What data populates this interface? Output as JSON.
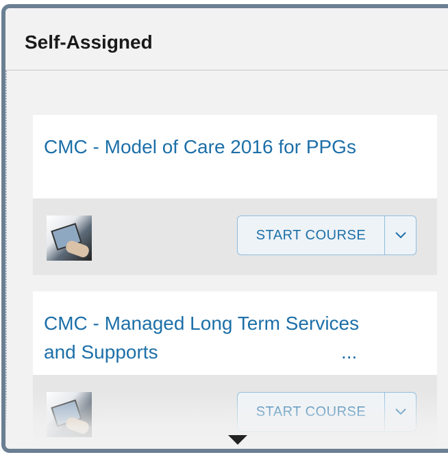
{
  "panel": {
    "title": "Self-Assigned"
  },
  "courses": [
    {
      "title": "CMC - Model of Care 2016 for PPGs",
      "ellipsis": "",
      "thumbnail_icon": "course-thumbnail",
      "start_label": "START COURSE",
      "dropdown_icon": "chevron-down-icon"
    },
    {
      "title": "CMC - Managed Long Term Services and Supports",
      "ellipsis": "...",
      "thumbnail_icon": "course-thumbnail",
      "start_label": "START COURSE",
      "dropdown_icon": "chevron-down-icon"
    }
  ],
  "scroll": {
    "icon": "triangle-down-icon"
  },
  "colors": {
    "accent": "#1c6fa8",
    "panel_border": "#6b7f93",
    "button_border": "#8fbddd"
  }
}
